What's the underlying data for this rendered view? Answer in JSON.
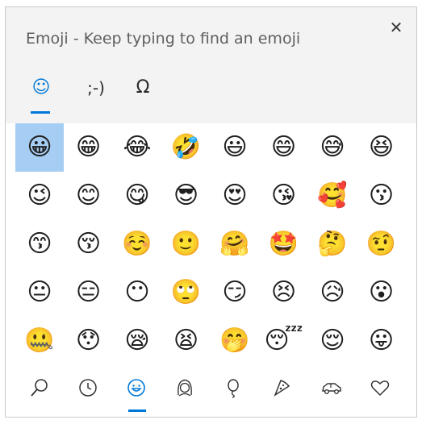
{
  "window": {
    "title": "Emoji - Keep typing to find an emoji",
    "close_icon": "✕"
  },
  "tabs": [
    {
      "name": "emoji",
      "label": "☺",
      "active": true
    },
    {
      "name": "kaomoji",
      "label": ";-)",
      "active": false
    },
    {
      "name": "symbols",
      "label": "Ω",
      "active": false
    }
  ],
  "emoji_grid": {
    "selected_index": 0,
    "columns": 8,
    "items": [
      "😀",
      "😁",
      "😂",
      "🤣",
      "😃",
      "😄",
      "😅",
      "😆",
      "😉",
      "😊",
      "😋",
      "😎",
      "😍",
      "😘",
      "🥰",
      "😗",
      "😙",
      "😚",
      "☺️",
      "🙂",
      "🤗",
      "🤩",
      "🤔",
      "🤨",
      "😐",
      "😑",
      "😶",
      "🙄",
      "😏",
      "😣",
      "😥",
      "😮",
      "🤐",
      "😯",
      "😪",
      "😫",
      "🤭",
      "😴",
      "😌",
      "😛"
    ]
  },
  "categories": [
    {
      "name": "search",
      "icon": "search-icon",
      "active": false
    },
    {
      "name": "recent",
      "icon": "clock-icon",
      "active": false
    },
    {
      "name": "smileys",
      "icon": "smiley-icon",
      "active": true
    },
    {
      "name": "people",
      "icon": "person-icon",
      "active": false
    },
    {
      "name": "celebrations",
      "icon": "balloon-icon",
      "active": false
    },
    {
      "name": "food",
      "icon": "pizza-icon",
      "active": false
    },
    {
      "name": "travel",
      "icon": "car-icon",
      "active": false
    },
    {
      "name": "symbols",
      "icon": "heart-icon",
      "active": false
    }
  ],
  "colors": {
    "accent": "#0078d7",
    "selection": "#a6cdf3"
  }
}
